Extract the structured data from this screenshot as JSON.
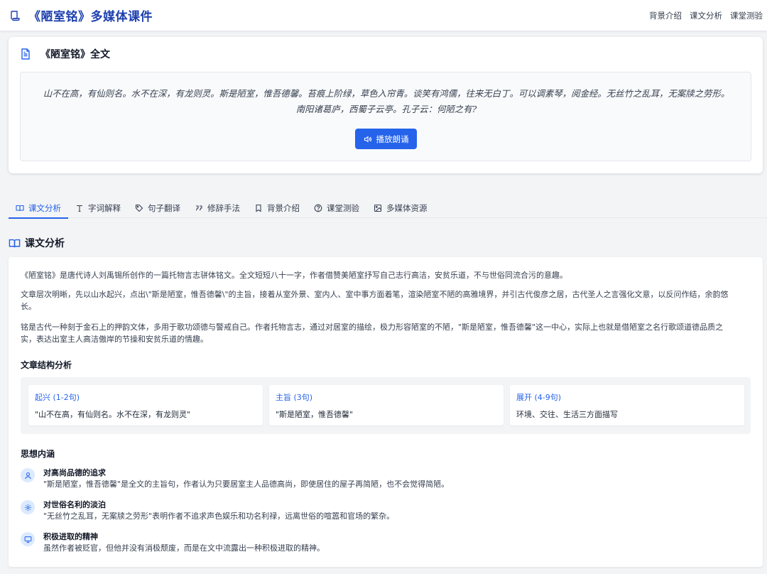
{
  "header": {
    "title": "《陋室铭》多媒体课件",
    "nav": [
      "背景介绍",
      "课文分析",
      "课堂测验"
    ]
  },
  "fulltext": {
    "title": "《陋室铭》全文",
    "line1": "山不在高，有仙则名。水不在深，有龙则灵。斯是陋室，惟吾德馨。苔痕上阶绿，草色入帘青。谈笑有鸿儒，往来无白丁。可以调素琴，阅金经。无丝竹之乱耳，无案牍之劳形。",
    "line2": "南阳诸葛庐，西蜀子云亭。孔子云：何陋之有?",
    "play_label": "播放朗诵"
  },
  "tabs": [
    {
      "label": "课文分析",
      "icon": "book-open-icon"
    },
    {
      "label": "字词解释",
      "icon": "text-type-icon"
    },
    {
      "label": "句子翻译",
      "icon": "tag-icon"
    },
    {
      "label": "修辞手法",
      "icon": "quote-icon"
    },
    {
      "label": "背景介绍",
      "icon": "bookmark-icon"
    },
    {
      "label": "课堂测验",
      "icon": "question-circle-icon"
    },
    {
      "label": "多媒体资源",
      "icon": "image-icon"
    }
  ],
  "analysis": {
    "title": "课文分析",
    "p1": "《陋室铭》是唐代诗人刘禹锡所创作的一篇托物言志骈体铭文。全文短短八十一字，作者借赞美陋室抒写自己志行高洁，安贫乐道，不与世俗同流合污的意趣。",
    "p2a": "文章层次明晰，先以山水起兴，点出\\\"斯是陋室，惟吾德馨\\\"的主旨，接着从室外景、室内人、室中事方面着笔，渲染陋室不陋的高雅境界，并引古代俊彦之居，古代圣人之言强化文意，以反问作结，余韵悠",
    "p2b": "长。",
    "p3a": "铭是古代一种刻于金石上的押韵文体，多用于歌功颂德与警戒自己。作者托物言志，通过对居室的描绘，极力形容陋室的不陋，\"斯是陋室，惟吾德馨\"这一中心，实际上也就是借陋室之名行歌颂道德品质之",
    "p3b": "实，表达出室主人高洁傲岸的节操和安贫乐道的情趣。",
    "structure_title": "文章结构分析",
    "structure": [
      {
        "label": "起兴 (1-2句)",
        "value": "\"山不在高，有仙则名。水不在深，有龙则灵\""
      },
      {
        "label": "主旨 (3句)",
        "value": "\"斯是陋室，惟吾德馨\""
      },
      {
        "label": "展开 (4-9句)",
        "value": "环境、交往、生活三方面描写"
      }
    ],
    "ideas_title": "思想内涵",
    "ideas": [
      {
        "icon": "user-icon",
        "title": "对高尚品德的追求",
        "desc": "\"斯是陋室，惟吾德馨\"是全文的主旨句，作者认为只要居室主人品德高尚，即使居住的屋子再简陋，也不会觉得简陋。"
      },
      {
        "icon": "gear-icon",
        "title": "对世俗名利的淡泊",
        "desc": "\"无丝竹之乱耳，无案牍之劳形\"表明作者不追求声色娱乐和功名利禄，远离世俗的喧嚣和官场的繁杂。"
      },
      {
        "icon": "monitor-icon",
        "title": "积极进取的精神",
        "desc": "虽然作者被贬官，但他并没有消极颓废，而是在文中流露出一种积极进取的精神。"
      }
    ]
  },
  "colors": {
    "accent": "#2563eb",
    "brand": "#1e40af",
    "icon_bg": "#dbeafe"
  }
}
